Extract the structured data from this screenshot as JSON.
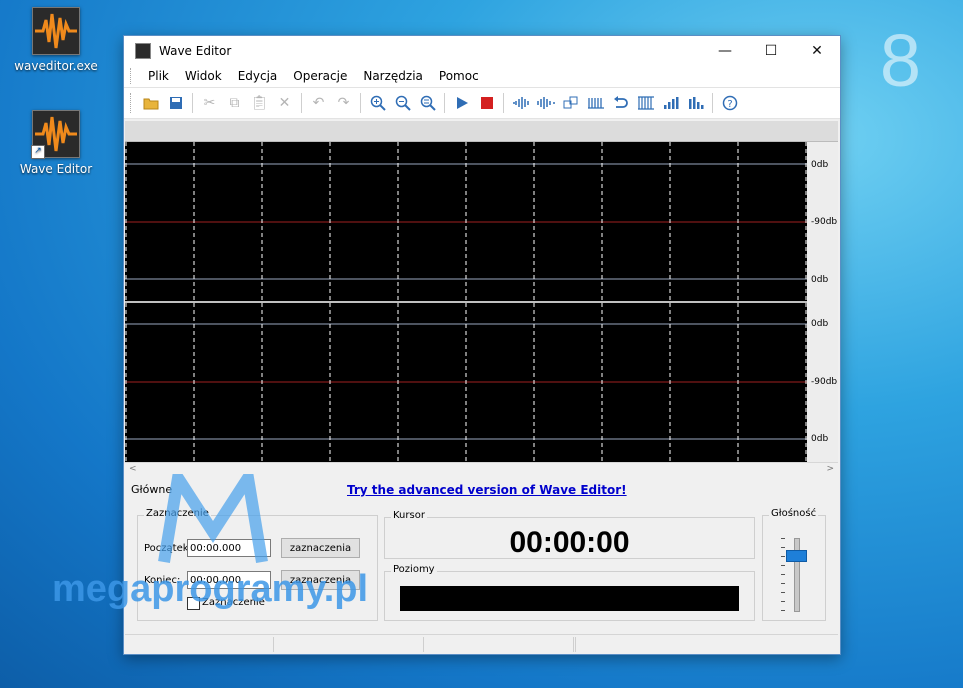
{
  "desktop": {
    "icons": [
      {
        "label": "waveditor.exe"
      },
      {
        "label": "Wave Editor"
      }
    ],
    "corner_digit": "8",
    "watermark": "megaprogramy.pl"
  },
  "window": {
    "title": "Wave Editor",
    "controls": {
      "minimize": "—",
      "maximize": "☐",
      "close": "✕"
    },
    "menu": [
      "Plik",
      "Widok",
      "Edycja",
      "Operacje",
      "Narzędzia",
      "Pomoc"
    ],
    "db_labels": [
      "0db",
      "-90db",
      "0db",
      "0db",
      "-90db",
      "0db"
    ],
    "bottom": {
      "tab_label": "Główne",
      "advanced_link": "Try the advanced version of Wave Editor!",
      "selection": {
        "legend": "Zaznaczenie",
        "start_label": "Początek",
        "start_value": "00:00.000",
        "start_button": "zaznaczenia",
        "end_label": "Koniec:",
        "end_value": "00:00.000",
        "end_button": "zaznaczenia",
        "checkbox_label": "Zaznaczenie"
      },
      "cursor": {
        "legend": "Kursor",
        "time": "00:00:00"
      },
      "levels": {
        "legend": "Poziomy"
      },
      "volume": {
        "legend": "Głośność",
        "level": 0.8
      }
    }
  },
  "colors": {
    "wave_bg": "#000000",
    "grid_line": "#ffffff",
    "channel_line": "#9aa8c0",
    "minus90_line": "#a02020",
    "link": "#0000cc",
    "accent": "#1e7fd8"
  }
}
